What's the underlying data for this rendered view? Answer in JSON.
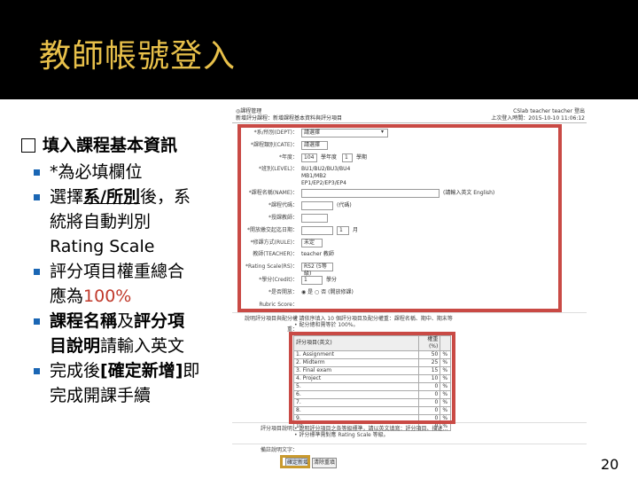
{
  "slide": {
    "title": "教師帳號登入",
    "page_number": "20"
  },
  "bullets": {
    "main": "填入課程基本資訊",
    "items": [
      {
        "t1": "*為必填欄位"
      },
      {
        "t1": "選擇",
        "t2": "系/所別",
        "t3": "後，系",
        "t4": "統將自動判別",
        "t5": "Rating Scale"
      },
      {
        "t1": "評分項目權重總合",
        "t2": "應為",
        "t3": "100%"
      },
      {
        "t1": "課程名稱",
        "t2": "及",
        "t3": "評分項",
        "t4": "目說明",
        "t5": "請輸入英文"
      },
      {
        "t1": "完成後",
        "t2": "[確定新增]",
        "t3": "即",
        "t4": "完成開課手續"
      }
    ]
  },
  "shot": {
    "header_left_1": "◎課程管理",
    "header_left_2": "新增評分課程：新增課程基本資料與評分項目",
    "header_right_1": "CSlab teacher teacher 登出",
    "header_right_2": "上次登入時間：2015-10-10 11:06:12",
    "rows": [
      {
        "label": "*系/所別(DEPT)：",
        "value": "請選擇"
      },
      {
        "label": "*課程類別(CATE)：",
        "value": "請選擇"
      },
      {
        "label": "*年度：",
        "value": "104",
        "extra": "學年度",
        "extra2": "1",
        "extra3": "學期"
      },
      {
        "label": "*班別(LEVEL)：",
        "value": "BU1/BU2/BU3/BU4"
      },
      {
        "label": "",
        "value": "MB1/MB2"
      },
      {
        "label": "",
        "value": "EP1/EP2/EP3/EP4"
      },
      {
        "label": "*課程名稱(NAME)：",
        "value": "",
        "extra": "(請輸入英文 English)"
      },
      {
        "label": "*課程代碼：",
        "value": "",
        "extra": "(代碼)"
      },
      {
        "label": "*授課教師：",
        "value": ""
      },
      {
        "label": "*開放繳交起迄日期：",
        "value": "",
        "extra": "1",
        "extra2": "月"
      },
      {
        "label": "*修課方式(RULE)：",
        "value": "未定"
      },
      {
        "label": "教師(TEACHER)：",
        "value": "teacher 教師"
      },
      {
        "label": "*Rating Scale(RS)：",
        "value": "RS2 (5等級)"
      },
      {
        "label": "*學分(Credit)：",
        "value": "1",
        "extra": "學分"
      },
      {
        "label": "*是否開放：",
        "value": "◉ 是 ○ 否 (開放修課)"
      },
      {
        "label": "Rubric Score：",
        "value": ""
      }
    ],
    "scoring_label": "說明評分項目與配分權重：",
    "scoring_notes": [
      "• 請依序填入 10 個評分項目及配分權重：課程名稱、期中、期末等",
      "• 配分總和需等於 100%。"
    ],
    "table_head_name": "評分項目(英文)",
    "table_head_weight": "權重(%)",
    "table_rows": [
      {
        "n": "1.",
        "name": "Assignment",
        "w": "50",
        "p": "%"
      },
      {
        "n": "2.",
        "name": "Midterm",
        "w": "25",
        "p": "%"
      },
      {
        "n": "3.",
        "name": "Final exam",
        "w": "15",
        "p": "%"
      },
      {
        "n": "4.",
        "name": "Project",
        "w": "10",
        "p": "%"
      },
      {
        "n": "5.",
        "name": "",
        "w": "0",
        "p": "%"
      },
      {
        "n": "6.",
        "name": "",
        "w": "0",
        "p": "%"
      },
      {
        "n": "7.",
        "name": "",
        "w": "0",
        "p": "%"
      },
      {
        "n": "8.",
        "name": "",
        "w": "0",
        "p": "%"
      },
      {
        "n": "9.",
        "name": "",
        "w": "0",
        "p": "%"
      },
      {
        "n": "10.",
        "name": "",
        "w": "0",
        "p": "%"
      }
    ],
    "rubric_label": "評分項目說明：",
    "rubric_notes": [
      "• 說明評分項目之各等級標準，請以英文填寫：評分項目、描述…",
      "• 評分標準需對應 Rating Scale 等級。"
    ],
    "remark_label": "備註說明文字：",
    "submit_label": "確定新增",
    "reset_label": "清除重填"
  }
}
